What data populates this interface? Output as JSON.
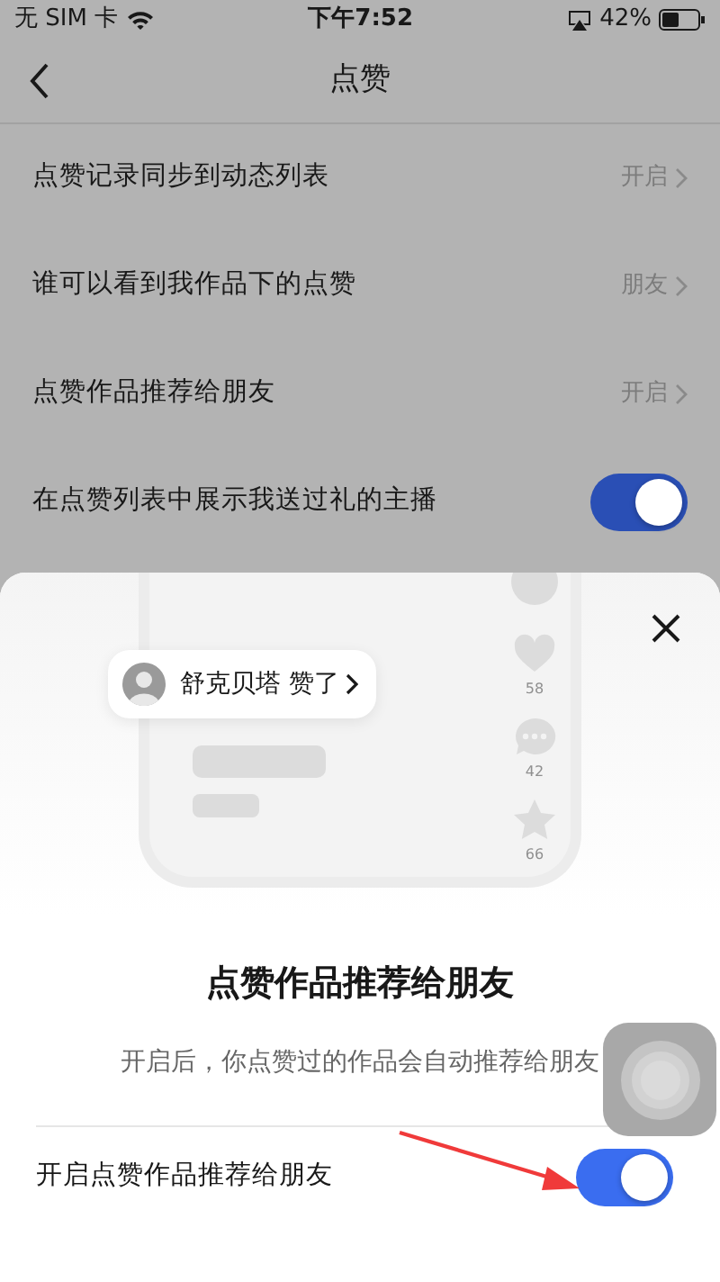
{
  "status_bar": {
    "carrier": "无 SIM 卡",
    "time": "下午7:52",
    "battery": "42%"
  },
  "nav": {
    "title": "点赞"
  },
  "settings": [
    {
      "kind": "link",
      "label": "点赞记录同步到动态列表",
      "value": "开启"
    },
    {
      "kind": "link",
      "label": "谁可以看到我作品下的点赞",
      "value": "朋友"
    },
    {
      "kind": "link",
      "label": "点赞作品推荐给朋友",
      "value": "开启"
    },
    {
      "kind": "toggle",
      "label": "在点赞列表中展示我送过礼的主播",
      "on": true
    }
  ],
  "sheet": {
    "preview": {
      "notification": "舒克贝塔 赞了",
      "counts": [
        "58",
        "42",
        "66"
      ]
    },
    "title": "点赞作品推荐给朋友",
    "description": "开启后，你点赞过的作品会自动推荐给朋友",
    "option": {
      "label": "开启点赞作品推荐给朋友",
      "on": true
    }
  }
}
